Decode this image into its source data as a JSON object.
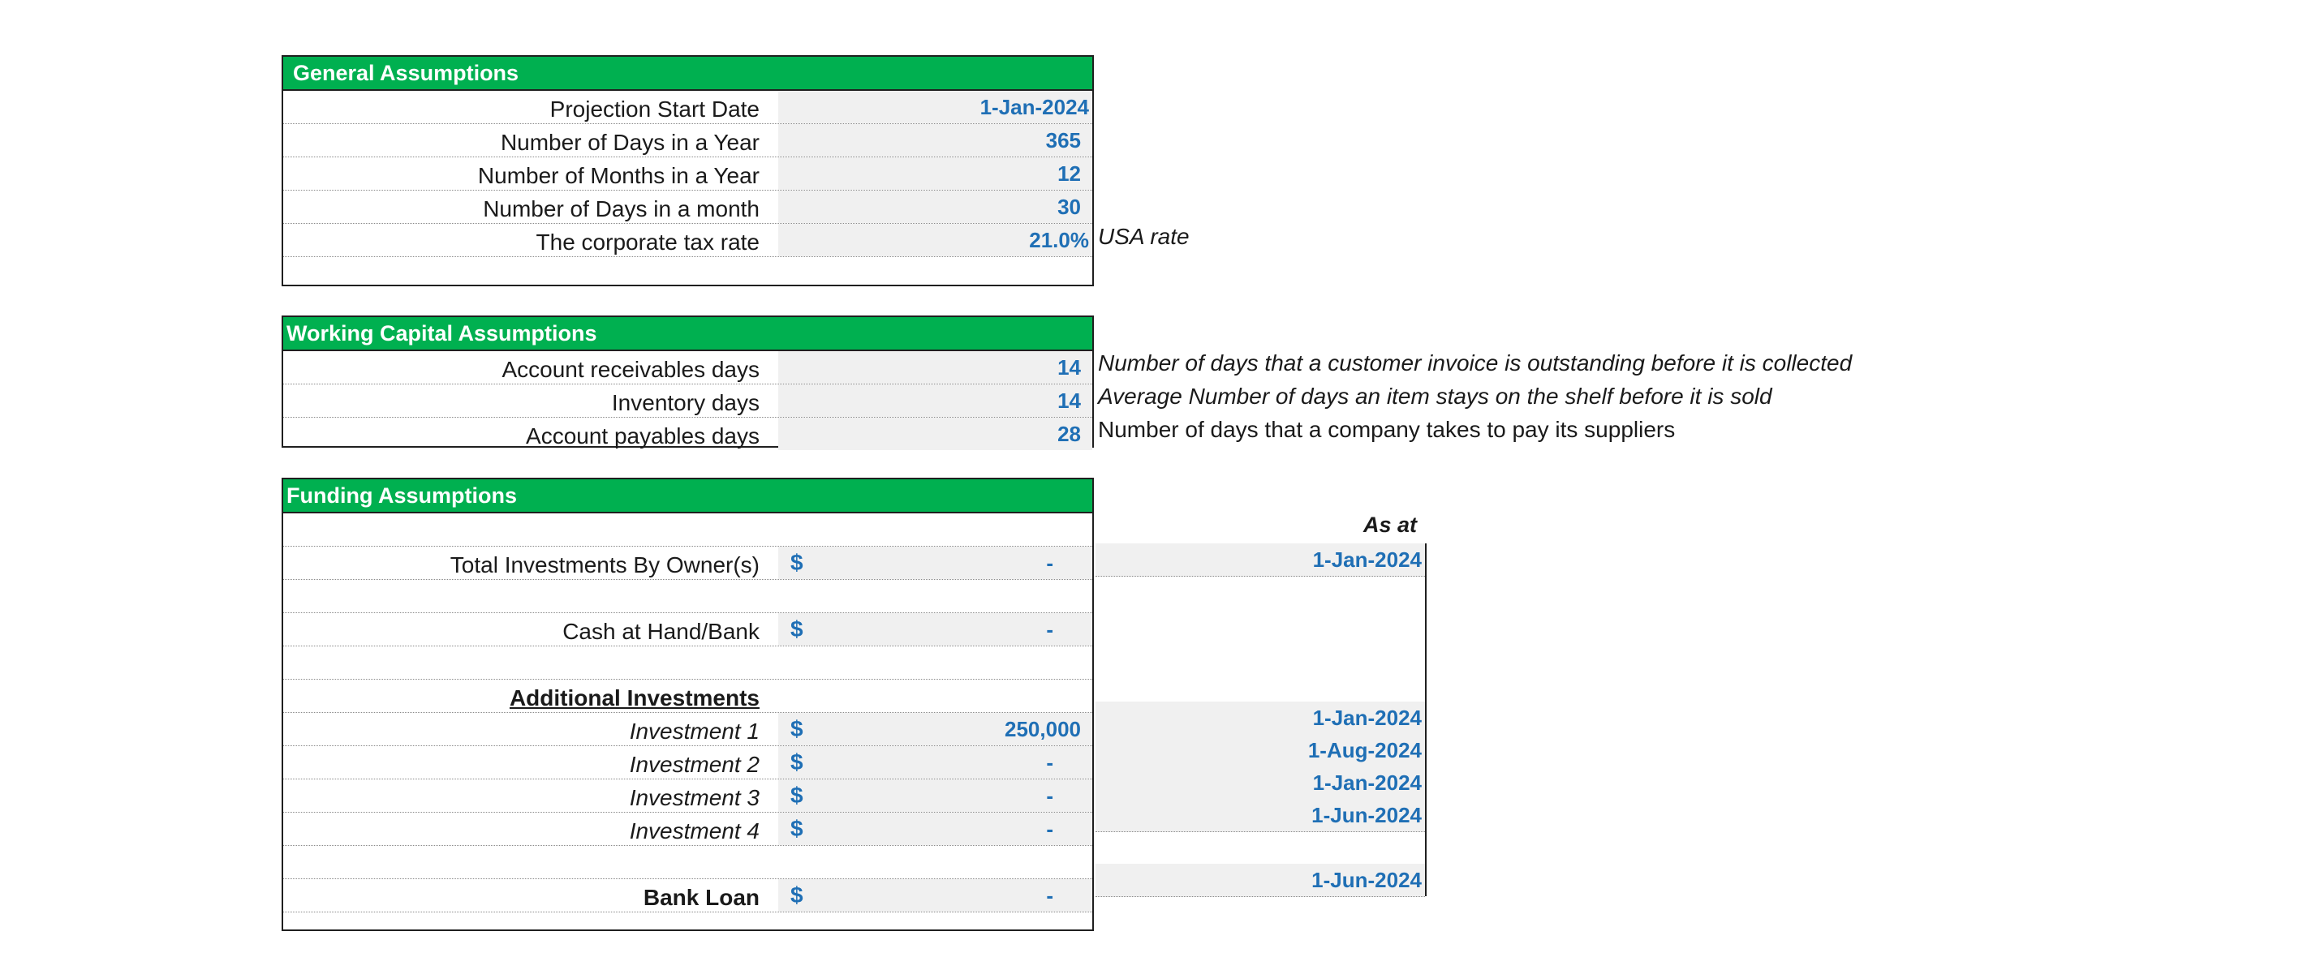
{
  "general": {
    "title": "General Assumptions",
    "rows": [
      {
        "label": "Projection Start Date",
        "value": "1-Jan-2024",
        "note": ""
      },
      {
        "label": "Number of Days in a Year",
        "value": "365",
        "note": ""
      },
      {
        "label": "Number of Months in a Year",
        "value": "12",
        "note": ""
      },
      {
        "label": "Number of Days in a month",
        "value": "30",
        "note": ""
      },
      {
        "label": "The corporate tax rate",
        "value": "21.0%",
        "note": "USA rate"
      }
    ]
  },
  "working_capital": {
    "title": "Working Capital Assumptions",
    "rows": [
      {
        "label": "Account receivables days",
        "value": "14",
        "note": "Number of days that a customer invoice is outstanding before it is collected"
      },
      {
        "label": "Inventory days",
        "value": "14",
        "note": "Average Number of days an item stays on the shelf before it is sold"
      },
      {
        "label": "Account payables days",
        "value": "28",
        "note": "Number of days that a company takes to pay its suppliers"
      }
    ]
  },
  "funding": {
    "title": "Funding Assumptions",
    "as_at_label": "As at",
    "currency_symbol": "$",
    "total_investments": {
      "label": "Total Investments By Owner(s)",
      "value": "-",
      "date": "1-Jan-2024"
    },
    "cash": {
      "label": "Cash at Hand/Bank",
      "value": "-"
    },
    "additional_header": "Additional Investments",
    "investments": [
      {
        "label": "Investment 1",
        "value": "250,000",
        "date": "1-Jan-2024"
      },
      {
        "label": "Investment 2",
        "value": "-",
        "date": "1-Aug-2024"
      },
      {
        "label": "Investment 3",
        "value": "-",
        "date": "1-Jan-2024"
      },
      {
        "label": "Investment 4",
        "value": "-",
        "date": "1-Jun-2024"
      }
    ],
    "bank_loan": {
      "label": "Bank Loan",
      "value": "-",
      "date": "1-Jun-2024"
    }
  },
  "colors": {
    "header_green": "#00b050",
    "value_blue": "#1f6fb5",
    "cell_gray": "#f0f0f0"
  }
}
